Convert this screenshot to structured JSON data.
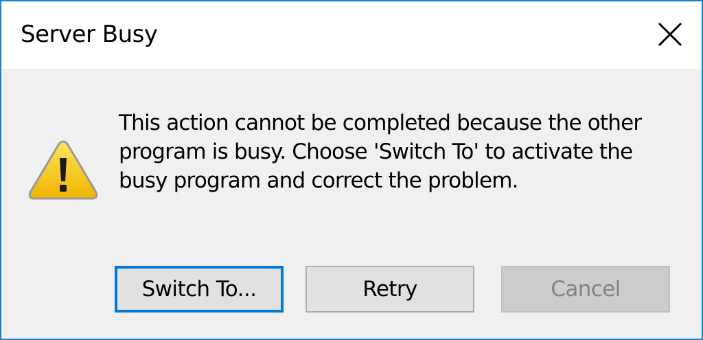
{
  "window": {
    "title": "Server Busy",
    "close_icon": "close-icon"
  },
  "message": {
    "icon": "warning-icon",
    "line1": "This action cannot be completed because the other",
    "line2": "program is busy. Choose 'Switch To' to activate the",
    "line3": "busy program and correct the problem."
  },
  "buttons": {
    "switch_to": "Switch To...",
    "retry": "Retry",
    "cancel": "Cancel"
  },
  "colors": {
    "window_border": "#1c7fd6",
    "dialog_background": "#f0f0f0",
    "default_button_border": "#0078d7",
    "warning_yellow": "#f5c400",
    "disabled_text": "#838383"
  }
}
